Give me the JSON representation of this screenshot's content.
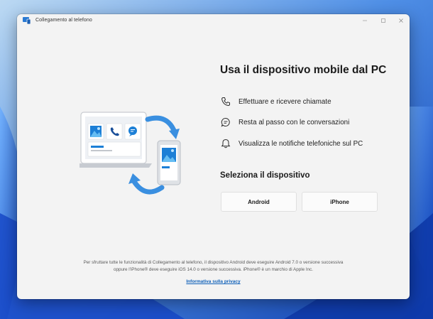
{
  "window": {
    "title": "Collegamento al telefono",
    "controls": [
      "minimize-icon",
      "maximize-icon",
      "close-icon"
    ]
  },
  "main": {
    "heading": "Usa il dispositivo mobile dal PC",
    "features": [
      {
        "icon": "phone-icon",
        "label": "Effettuare e ricevere chiamate"
      },
      {
        "icon": "chat-icon",
        "label": "Resta al passo con le conversazioni"
      },
      {
        "icon": "bell-icon",
        "label": "Visualizza le notifiche telefoniche sul PC"
      }
    ],
    "select_heading": "Seleziona il dispositivo",
    "buttons": {
      "android": "Android",
      "iphone": "iPhone"
    }
  },
  "footer": {
    "disclaimer_line1": "Per sfruttare tutte le funzionalità di Collegamento al telefono, il dispositivo Android deve eseguire Android 7.0 o versione successiva",
    "disclaimer_line2": "oppure l'iPhone® deve eseguire iOS 14.0 o versione successiva. iPhone® è un marchio di Apple Inc.",
    "privacy_link": "Informativa sulla privacy"
  },
  "colors": {
    "accent": "#0d5fb8",
    "window_bg": "#f3f3f3",
    "desktop": "#1d5bd0"
  }
}
